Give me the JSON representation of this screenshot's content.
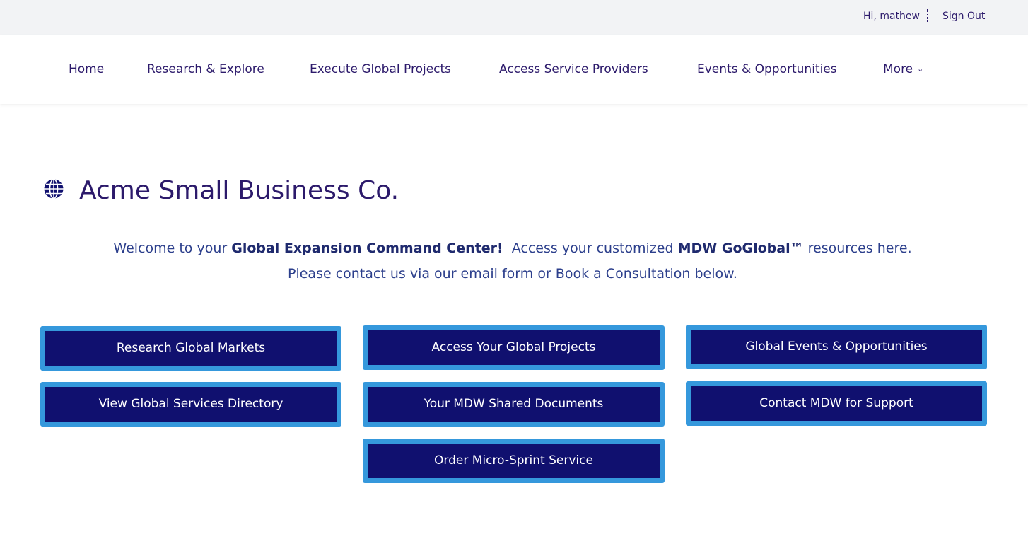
{
  "utility_bar": {
    "greeting": "Hi, mathew",
    "sign_out": "Sign Out"
  },
  "nav": {
    "items": [
      {
        "label": "Home"
      },
      {
        "label": "Research & Explore"
      },
      {
        "label": "Execute Global Projects"
      },
      {
        "label": "Access Service Providers"
      },
      {
        "label": "Events & Opportunities"
      },
      {
        "label": "More"
      }
    ],
    "more_chevron": "⌄"
  },
  "company": {
    "name": "Acme Small Business Co.",
    "icon": "globe-icon"
  },
  "welcome": {
    "part1": "Welcome to your ",
    "bold1": "Global Expansion Command Center!",
    "part2": "  Access your customized ",
    "bold2": "MDW GoGlobal™",
    "part3": " resources here.",
    "line2": "Please contact us via our email form or Book a Consultation below."
  },
  "buttons": {
    "research_global_markets": "Research Global Markets",
    "access_global_projects": "Access Your Global Projects",
    "global_events": "Global Events & Opportunities",
    "view_services_directory": "View Global Services Directory",
    "shared_documents": "Your MDW Shared Documents",
    "contact_support": "Contact MDW for Support",
    "order_micro_sprint": "Order Micro-Sprint Service"
  },
  "colors": {
    "brand_text": "#2c1a6b",
    "button_fill": "#10106f",
    "button_border": "#3598dc",
    "utility_bg": "#f2f3f5"
  }
}
